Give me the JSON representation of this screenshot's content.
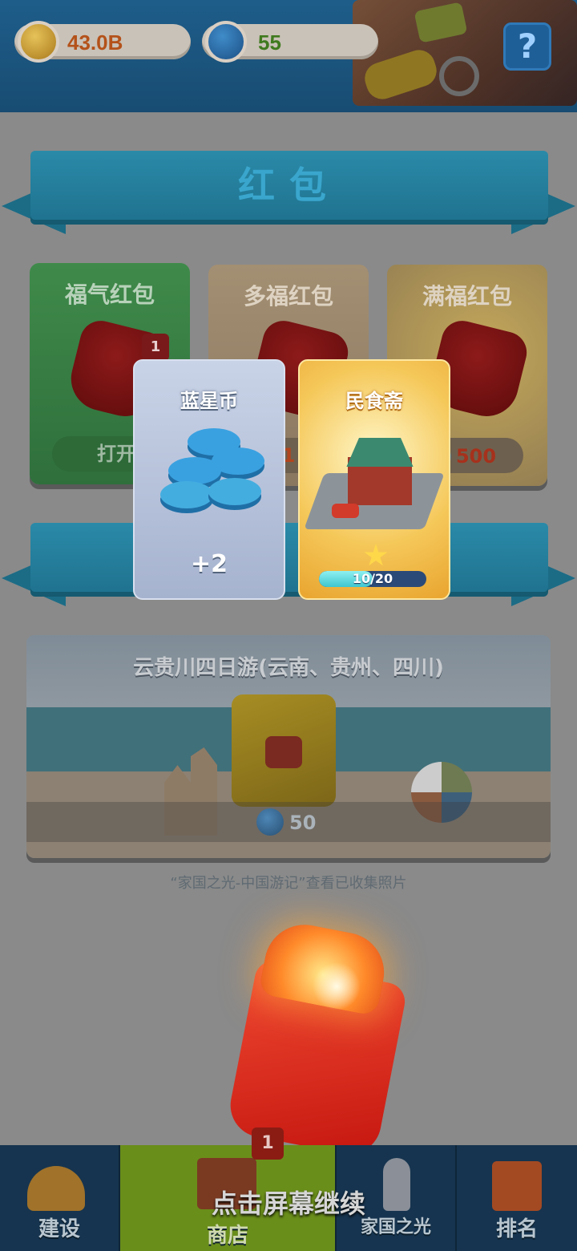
{
  "topbar": {
    "gold_amount": "43.0B",
    "star_amount": "55",
    "help_symbol": "?"
  },
  "section_redpacket": {
    "title": "红包"
  },
  "redpackets": [
    {
      "title": "福气红包",
      "badge": "1",
      "button": "打开"
    },
    {
      "title": "多福红包",
      "price": "1"
    },
    {
      "title": "满福红包",
      "price": "500"
    }
  ],
  "travel": {
    "title": "云贵川四日游(云南、贵州、四川)",
    "price": "50",
    "note": "“家国之光-中国游记”查看已收集照片"
  },
  "rewards": [
    {
      "title": "蓝星币",
      "amount": "+2"
    },
    {
      "title": "民食斋",
      "progress_text": "10/20",
      "progress_value": 10,
      "progress_max": 20
    }
  ],
  "continue_hint": "点击屏幕继续",
  "nav": {
    "items": [
      {
        "label": "建设"
      },
      {
        "label": "商店",
        "badge": "1"
      },
      {
        "label": "家国之光"
      },
      {
        "label": "排名"
      }
    ]
  },
  "colors": {
    "gold_text": "#b4521a",
    "star_text": "#3f7a1f",
    "shop_active": "#6a8e1a"
  }
}
